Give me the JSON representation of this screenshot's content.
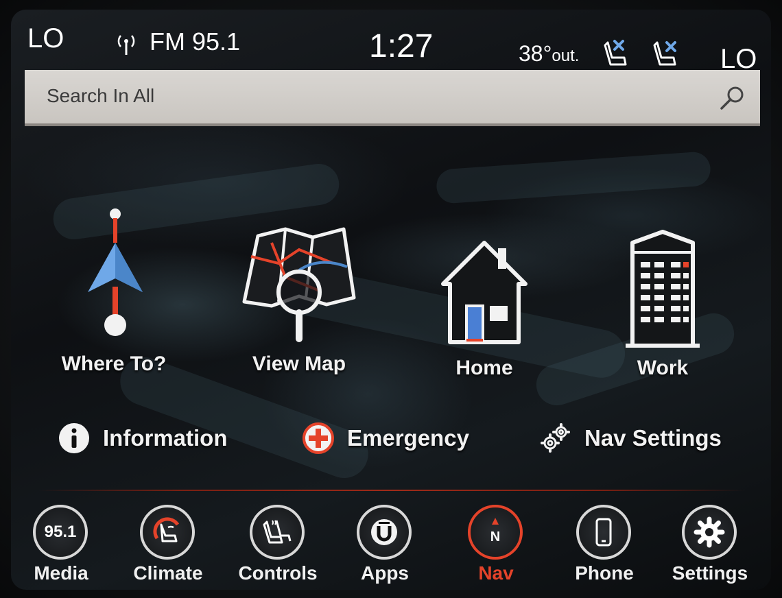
{
  "status": {
    "climate_left": "LO",
    "radio": "FM 95.1",
    "clock": "1:27",
    "temperature": "38°",
    "temperature_suffix": "out.",
    "climate_right": "LO"
  },
  "search": {
    "placeholder": "Search In All"
  },
  "tiles": {
    "where_to": "Where To?",
    "view_map": "View Map",
    "home": "Home",
    "work": "Work"
  },
  "options": {
    "information": "Information",
    "emergency": "Emergency",
    "nav_settings": "Nav Settings"
  },
  "dock": {
    "media_value": "95.1",
    "media": "Media",
    "climate": "Climate",
    "controls": "Controls",
    "apps": "Apps",
    "nav": "Nav",
    "nav_compass_letter": "N",
    "phone": "Phone",
    "settings": "Settings"
  },
  "colors": {
    "accent_red": "#e5432a",
    "arrow_blue": "#6fa8e8",
    "door_blue": "#4a7fd4"
  },
  "icons": {
    "where_to": "navigation-arrow-icon",
    "view_map": "map-magnifier-icon",
    "home": "house-icon",
    "work": "office-building-icon",
    "information": "info-icon",
    "emergency": "plus-icon",
    "nav_settings": "gears-icon"
  }
}
